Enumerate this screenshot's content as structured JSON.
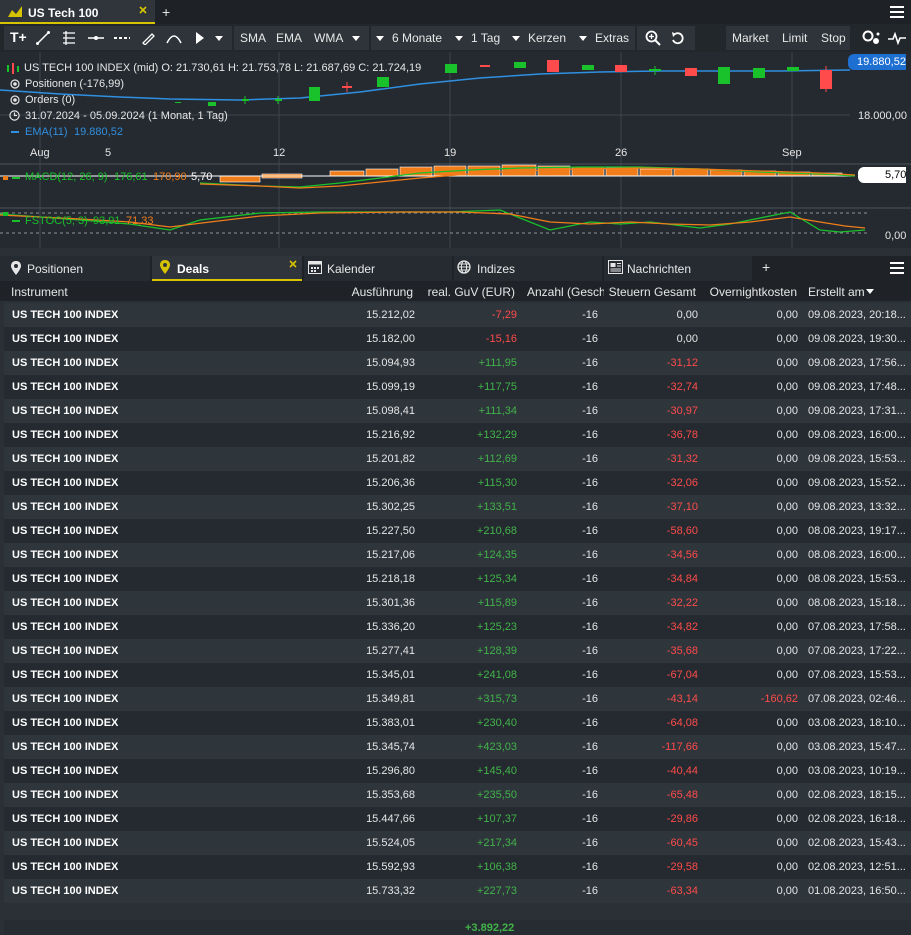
{
  "tabs": {
    "title": "US Tech 100",
    "add": "+"
  },
  "toolbar": {
    "sma": "SMA",
    "ema": "EMA",
    "wma": "WMA",
    "period": "6 Monate",
    "interval": "1 Tag",
    "type": "Kerzen",
    "extras": "Extras",
    "market": "Market",
    "limit": "Limit",
    "stop": "Stop"
  },
  "chart": {
    "ohlc": "US TECH 100 INDEX (mid)  O: 21.730,61  H: 21.753,78  L: 21.687,69  C: 21.724,19",
    "positions": "Positionen (-176,99)",
    "orders": "Orders (0)",
    "range": "31.07.2024 - 05.09.2024  (1 Monat, 1 Tag)",
    "ema_label": "EMA(11)",
    "ema_value": "19.880,52",
    "price_flag": "19.880,52",
    "price_level": "18.000,00",
    "x_ticks": [
      "Aug",
      "5",
      "12",
      "19",
      "26",
      "Sep"
    ],
    "macd_label": "MACD(12, 26, 9)",
    "macd_v1": "176,61",
    "macd_v2": "170,90",
    "macd_v3": "5,70",
    "macd_flag": "5,70",
    "fstoc_label": "FSTOC(5, 3)",
    "fstoc_v1": "93,91",
    "fstoc_v2": "71,33",
    "fstoc_level": "0,00"
  },
  "panel": {
    "positionen": "Positionen",
    "deals": "Deals",
    "kalender": "Kalender",
    "indizes": "Indizes",
    "nachrichten": "Nachrichten",
    "add": "+"
  },
  "table": {
    "headers": {
      "instrument": "Instrument",
      "ausfuehrung": "Ausführung",
      "guv": "real. GuV (EUR)",
      "anzahl": "Anzahl (Geschl",
      "steuern": "Steuern Gesamt",
      "overnight": "Overnightkosten",
      "erstellt": "Erstellt am"
    },
    "rows": [
      {
        "inst": "US TECH 100 INDEX",
        "exe": "15.212,02",
        "guv": "-7,29",
        "anz": "-16",
        "st": "0,00",
        "on": "0,00",
        "dt": "09.08.2023, 20:18..."
      },
      {
        "inst": "US TECH 100 INDEX",
        "exe": "15.182,00",
        "guv": "-15,16",
        "anz": "-16",
        "st": "0,00",
        "on": "0,00",
        "dt": "09.08.2023, 19:30..."
      },
      {
        "inst": "US TECH 100 INDEX",
        "exe": "15.094,93",
        "guv": "+111,95",
        "anz": "-16",
        "st": "-31,12",
        "on": "0,00",
        "dt": "09.08.2023, 17:56..."
      },
      {
        "inst": "US TECH 100 INDEX",
        "exe": "15.099,19",
        "guv": "+117,75",
        "anz": "-16",
        "st": "-32,74",
        "on": "0,00",
        "dt": "09.08.2023, 17:48..."
      },
      {
        "inst": "US TECH 100 INDEX",
        "exe": "15.098,41",
        "guv": "+111,34",
        "anz": "-16",
        "st": "-30,97",
        "on": "0,00",
        "dt": "09.08.2023, 17:31..."
      },
      {
        "inst": "US TECH 100 INDEX",
        "exe": "15.216,92",
        "guv": "+132,29",
        "anz": "-16",
        "st": "-36,78",
        "on": "0,00",
        "dt": "09.08.2023, 16:00..."
      },
      {
        "inst": "US TECH 100 INDEX",
        "exe": "15.201,82",
        "guv": "+112,69",
        "anz": "-16",
        "st": "-31,32",
        "on": "0,00",
        "dt": "09.08.2023, 15:53..."
      },
      {
        "inst": "US TECH 100 INDEX",
        "exe": "15.206,36",
        "guv": "+115,30",
        "anz": "-16",
        "st": "-32,06",
        "on": "0,00",
        "dt": "09.08.2023, 15:52..."
      },
      {
        "inst": "US TECH 100 INDEX",
        "exe": "15.302,25",
        "guv": "+133,51",
        "anz": "-16",
        "st": "-37,10",
        "on": "0,00",
        "dt": "09.08.2023, 13:32..."
      },
      {
        "inst": "US TECH 100 INDEX",
        "exe": "15.227,50",
        "guv": "+210,68",
        "anz": "-16",
        "st": "-58,60",
        "on": "0,00",
        "dt": "08.08.2023, 19:17..."
      },
      {
        "inst": "US TECH 100 INDEX",
        "exe": "15.217,06",
        "guv": "+124,35",
        "anz": "-16",
        "st": "-34,56",
        "on": "0,00",
        "dt": "08.08.2023, 16:00..."
      },
      {
        "inst": "US TECH 100 INDEX",
        "exe": "15.218,18",
        "guv": "+125,34",
        "anz": "-16",
        "st": "-34,84",
        "on": "0,00",
        "dt": "08.08.2023, 15:53..."
      },
      {
        "inst": "US TECH 100 INDEX",
        "exe": "15.301,36",
        "guv": "+115,89",
        "anz": "-16",
        "st": "-32,22",
        "on": "0,00",
        "dt": "08.08.2023, 15:18..."
      },
      {
        "inst": "US TECH 100 INDEX",
        "exe": "15.336,20",
        "guv": "+125,23",
        "anz": "-16",
        "st": "-34,82",
        "on": "0,00",
        "dt": "07.08.2023, 17:58..."
      },
      {
        "inst": "US TECH 100 INDEX",
        "exe": "15.277,41",
        "guv": "+128,39",
        "anz": "-16",
        "st": "-35,68",
        "on": "0,00",
        "dt": "07.08.2023, 17:22..."
      },
      {
        "inst": "US TECH 100 INDEX",
        "exe": "15.345,01",
        "guv": "+241,08",
        "anz": "-16",
        "st": "-67,04",
        "on": "0,00",
        "dt": "07.08.2023, 15:53..."
      },
      {
        "inst": "US TECH 100 INDEX",
        "exe": "15.349,81",
        "guv": "+315,73",
        "anz": "-16",
        "st": "-43,14",
        "on": "-160,62",
        "dt": "07.08.2023, 02:46..."
      },
      {
        "inst": "US TECH 100 INDEX",
        "exe": "15.383,01",
        "guv": "+230,40",
        "anz": "-16",
        "st": "-64,08",
        "on": "0,00",
        "dt": "03.08.2023, 18:10..."
      },
      {
        "inst": "US TECH 100 INDEX",
        "exe": "15.345,74",
        "guv": "+423,03",
        "anz": "-16",
        "st": "-117,66",
        "on": "0,00",
        "dt": "03.08.2023, 15:47..."
      },
      {
        "inst": "US TECH 100 INDEX",
        "exe": "15.296,80",
        "guv": "+145,40",
        "anz": "-16",
        "st": "-40,44",
        "on": "0,00",
        "dt": "03.08.2023, 10:19..."
      },
      {
        "inst": "US TECH 100 INDEX",
        "exe": "15.353,68",
        "guv": "+235,50",
        "anz": "-16",
        "st": "-65,48",
        "on": "0,00",
        "dt": "02.08.2023, 18:15..."
      },
      {
        "inst": "US TECH 100 INDEX",
        "exe": "15.447,66",
        "guv": "+107,37",
        "anz": "-16",
        "st": "-29,86",
        "on": "0,00",
        "dt": "02.08.2023, 16:18..."
      },
      {
        "inst": "US TECH 100 INDEX",
        "exe": "15.524,05",
        "guv": "+217,34",
        "anz": "-16",
        "st": "-60,45",
        "on": "0,00",
        "dt": "02.08.2023, 15:43..."
      },
      {
        "inst": "US TECH 100 INDEX",
        "exe": "15.592,93",
        "guv": "+106,38",
        "anz": "-16",
        "st": "-29,58",
        "on": "0,00",
        "dt": "02.08.2023, 12:51..."
      },
      {
        "inst": "US TECH 100 INDEX",
        "exe": "15.733,32",
        "guv": "+227,73",
        "anz": "-16",
        "st": "-63,34",
        "on": "0,00",
        "dt": "01.08.2023, 16:50..."
      }
    ],
    "total": "+3.892,22"
  },
  "colors": {
    "positive": "#42b34a",
    "negative": "#ff4b4b",
    "accent": "#d7c400",
    "ema": "#2f8fe0",
    "macd": "#19c22b",
    "signal": "#f07d1a",
    "flag": "#1d6fd1"
  }
}
